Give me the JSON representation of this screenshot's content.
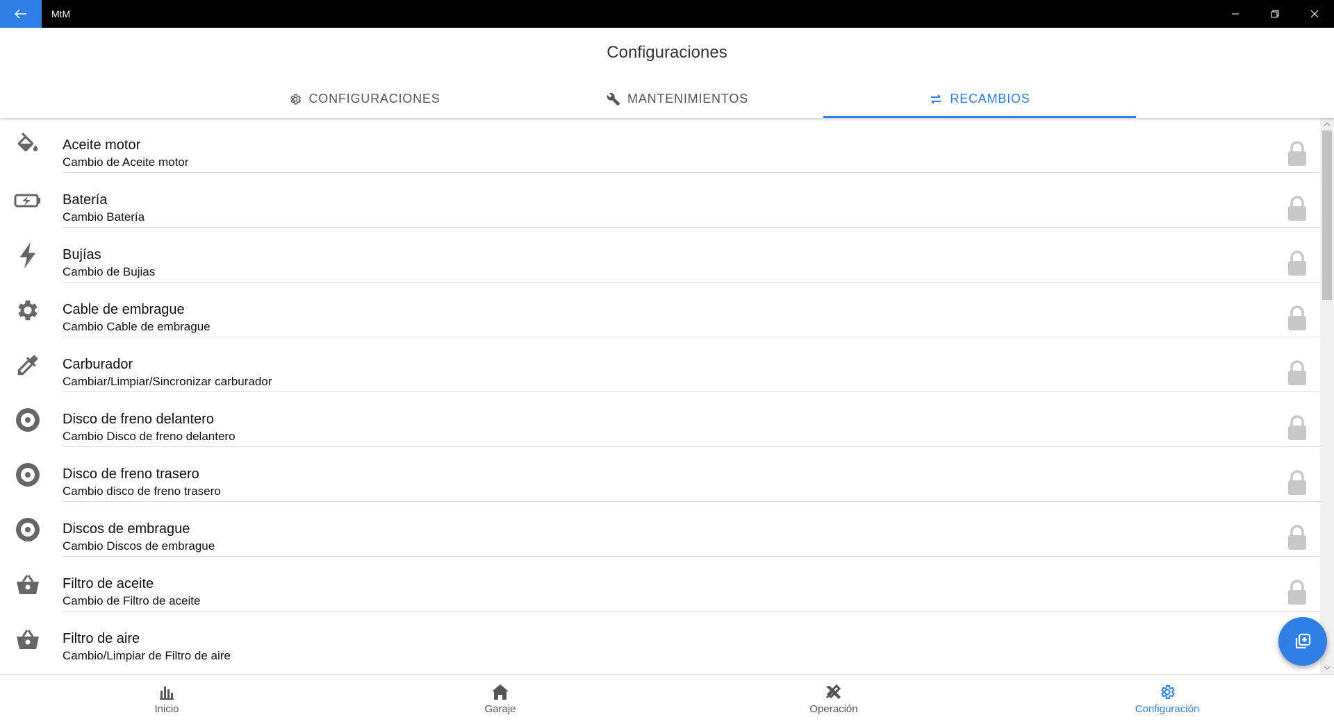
{
  "window": {
    "title": "MtM"
  },
  "header": {
    "title": "Configuraciones"
  },
  "tabs": [
    {
      "label": "CONFIGURACIONES",
      "icon": "gear-icon",
      "active": false
    },
    {
      "label": "MANTENIMIENTOS",
      "icon": "wrench-icon",
      "active": false
    },
    {
      "label": "RECAMBIOS",
      "icon": "swap-arrows-icon",
      "active": true
    }
  ],
  "items": [
    {
      "title": "Aceite motor",
      "subtitle": "Cambio de Aceite motor",
      "icon": "oil-can-icon",
      "locked": true
    },
    {
      "title": "Batería",
      "subtitle": "Cambio Batería",
      "icon": "battery-charging-icon",
      "locked": true
    },
    {
      "title": "Bujías",
      "subtitle": "Cambio de Bujias",
      "icon": "bolt-icon",
      "locked": true
    },
    {
      "title": "Cable de embrague",
      "subtitle": "Cambio Cable de embrague",
      "icon": "gear-icon",
      "locked": true
    },
    {
      "title": "Carburador",
      "subtitle": "Cambiar/Limpiar/Sincronizar carburador",
      "icon": "eyedropper-icon",
      "locked": true
    },
    {
      "title": "Disco de freno delantero",
      "subtitle": "Cambio Disco de freno delantero",
      "icon": "disc-icon",
      "locked": true
    },
    {
      "title": "Disco de freno trasero",
      "subtitle": "Cambio disco de freno trasero",
      "icon": "disc-icon",
      "locked": true
    },
    {
      "title": "Discos de embrague",
      "subtitle": "Cambio Discos de embrague",
      "icon": "disc-icon",
      "locked": true
    },
    {
      "title": "Filtro de aceite",
      "subtitle": "Cambio de Filtro de aceite",
      "icon": "basket-icon",
      "locked": true
    },
    {
      "title": "Filtro de aire",
      "subtitle": "Cambio/Limpiar de Filtro de aire",
      "icon": "basket-icon",
      "locked": false
    }
  ],
  "bottom_nav": [
    {
      "label": "Inicio",
      "icon": "bar-chart-icon",
      "active": false
    },
    {
      "label": "Garaje",
      "icon": "home-icon",
      "active": false
    },
    {
      "label": "Operación",
      "icon": "tools-icon",
      "active": false
    },
    {
      "label": "Configuración",
      "icon": "gear-icon",
      "active": true
    }
  ],
  "fab": {
    "icon": "add-copy-icon"
  },
  "colors": {
    "accent": "#2f7fe6",
    "icon_gray": "#666666",
    "lock_gray": "#c8c8c8"
  }
}
